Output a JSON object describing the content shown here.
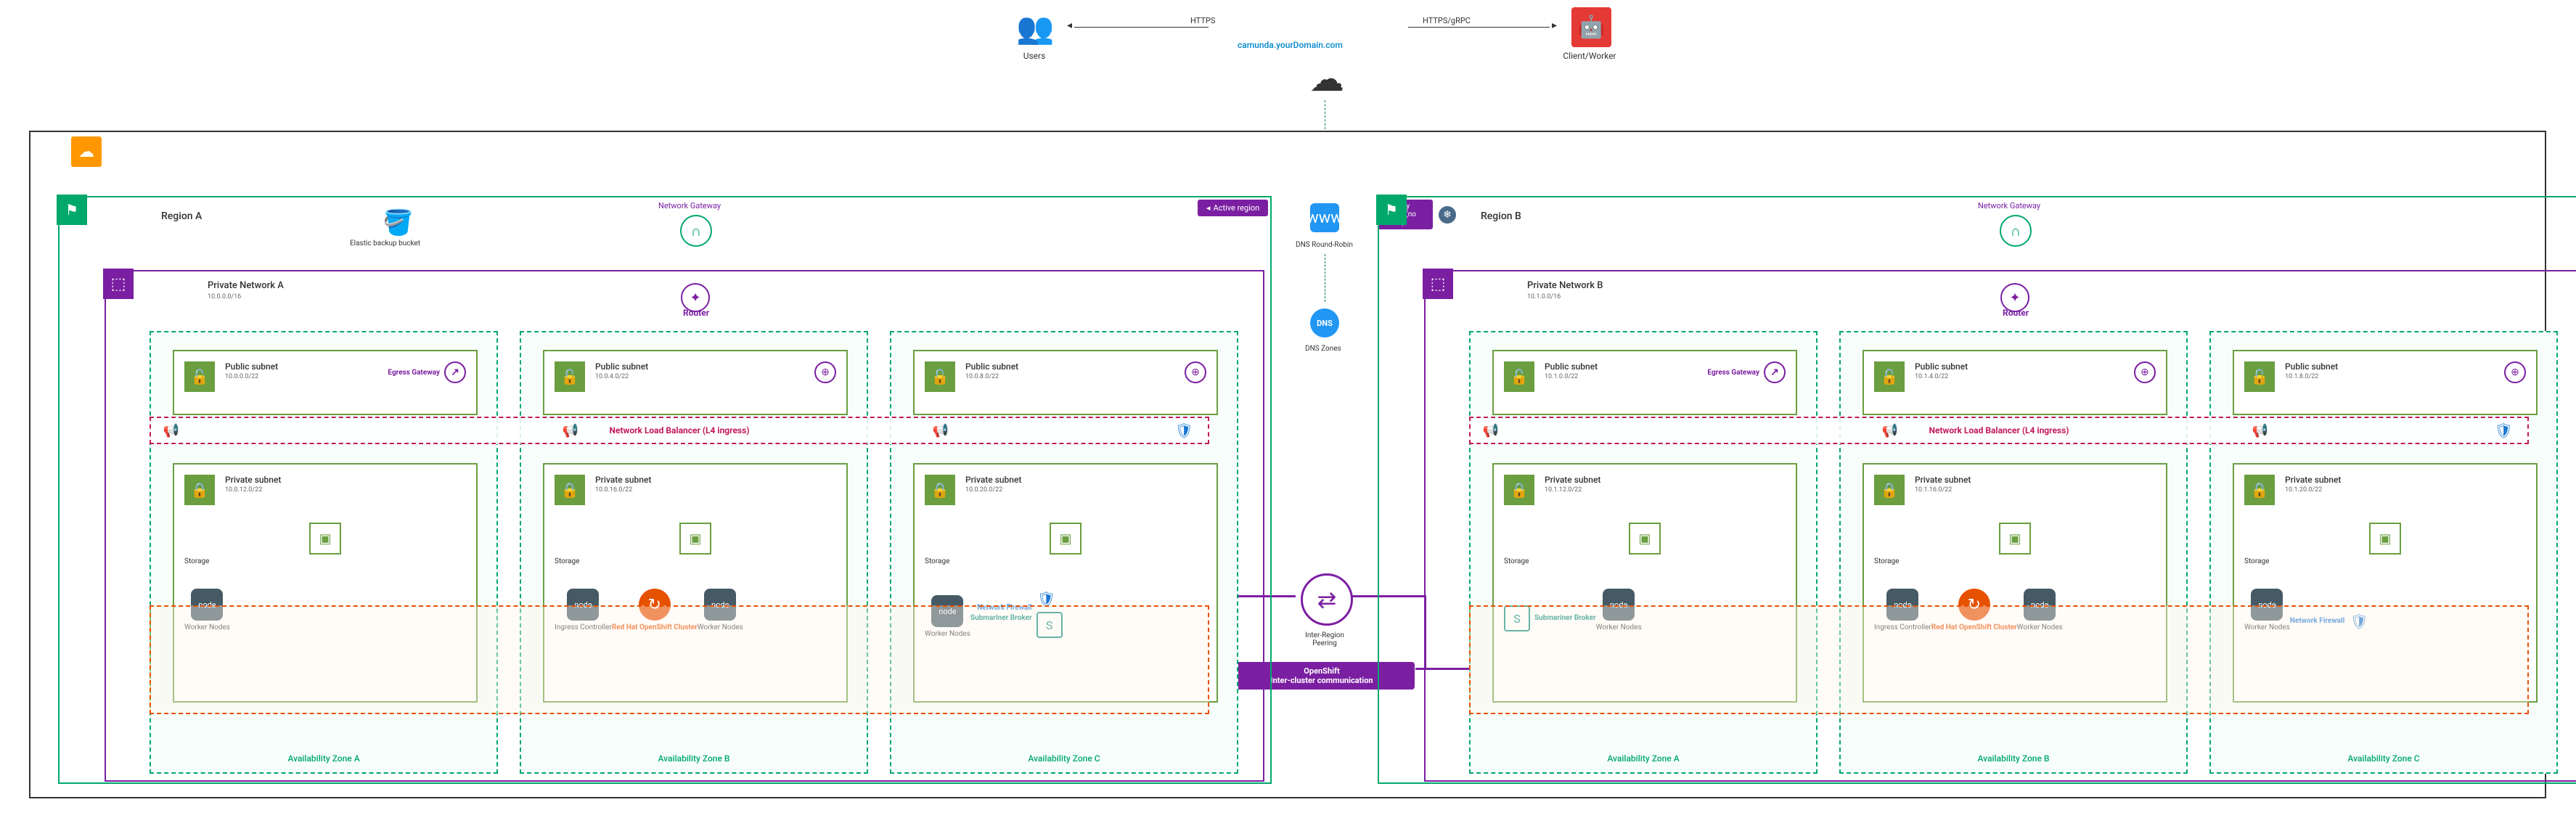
{
  "top": {
    "users_label": "Users",
    "client_label": "Client/Worker",
    "https_label": "HTTPS",
    "https_grpc_label": "HTTPS/gRPC",
    "domain": "camunda.yourDomain.com",
    "dns_round_robin": "DNS Round-Robin",
    "dns_zones": "DNS Zones",
    "dns_text": "DNS",
    "isp_text": "www",
    "peering_label": "Inter-Region Peering",
    "openshift_line1": "OpenShift",
    "openshift_line2": "Inter-cluster communication",
    "active_region": "Active region",
    "standby_region": "Standby region (no traffic)"
  },
  "regions": {
    "a": {
      "title": "Region A",
      "bucket_label": "Elastic backup bucket",
      "gateway_label": "Network Gateway",
      "pn_title": "Private Network A",
      "pn_cidr": "10.0.0.0/16",
      "router_label": "Router",
      "nlb_label": "Network Load Balancer (L4 ingress)",
      "egress_label": "Egress Gateway",
      "ocp_label": "Red Hat OpenShift Cluster",
      "ingress_label": "Ingress Controller",
      "submariner_label": "Submariner Broker",
      "netfw_label": "Network Firewall",
      "storage_label": "Storage",
      "worker_label": "Worker Nodes",
      "node_text": "node",
      "az": {
        "a": {
          "title": "Availability Zone A",
          "pub_title": "Public subnet",
          "pub_cidr": "10.0.0.0/22",
          "priv_title": "Private subnet",
          "priv_cidr": "10.0.12.0/22"
        },
        "b": {
          "title": "Availability Zone B",
          "pub_title": "Public subnet",
          "pub_cidr": "10.0.4.0/22",
          "priv_title": "Private subnet",
          "priv_cidr": "10.0.16.0/22"
        },
        "c": {
          "title": "Availability Zone C",
          "pub_title": "Public subnet",
          "pub_cidr": "10.0.8.0/22",
          "priv_title": "Private subnet",
          "priv_cidr": "10.0.20.0/22"
        }
      }
    },
    "b": {
      "title": "Region B",
      "gateway_label": "Network Gateway",
      "pn_title": "Private Network B",
      "pn_cidr": "10.1.0.0/16",
      "router_label": "Router",
      "nlb_label": "Network Load Balancer (L4 ingress)",
      "egress_label": "Egress Gateway",
      "ocp_label": "Red Hat OpenShift Cluster",
      "ingress_label": "Ingress Controller",
      "submariner_label": "Submariner Broker",
      "netfw_label": "Network Firewall",
      "storage_label": "Storage",
      "worker_label": "Worker Nodes",
      "node_text": "node",
      "az": {
        "a": {
          "title": "Availability Zone A",
          "pub_title": "Public subnet",
          "pub_cidr": "10.1.0.0/22",
          "priv_title": "Private subnet",
          "priv_cidr": "10.1.12.0/22"
        },
        "b": {
          "title": "Availability Zone B",
          "pub_title": "Public subnet",
          "pub_cidr": "10.1.4.0/22",
          "priv_title": "Private subnet",
          "priv_cidr": "10.1.16.0/22"
        },
        "c": {
          "title": "Availability Zone C",
          "pub_title": "Public subnet",
          "pub_cidr": "10.1.8.0/22",
          "priv_title": "Private subnet",
          "priv_cidr": "10.1.20.0/22"
        }
      }
    }
  },
  "colors": {
    "green": "#00a86b",
    "purple": "#7b1fa2",
    "olive": "#6a9e3f",
    "orange": "#e65100",
    "magenta": "#c2185b",
    "blue": "#1976d2",
    "teal": "#00897b"
  }
}
